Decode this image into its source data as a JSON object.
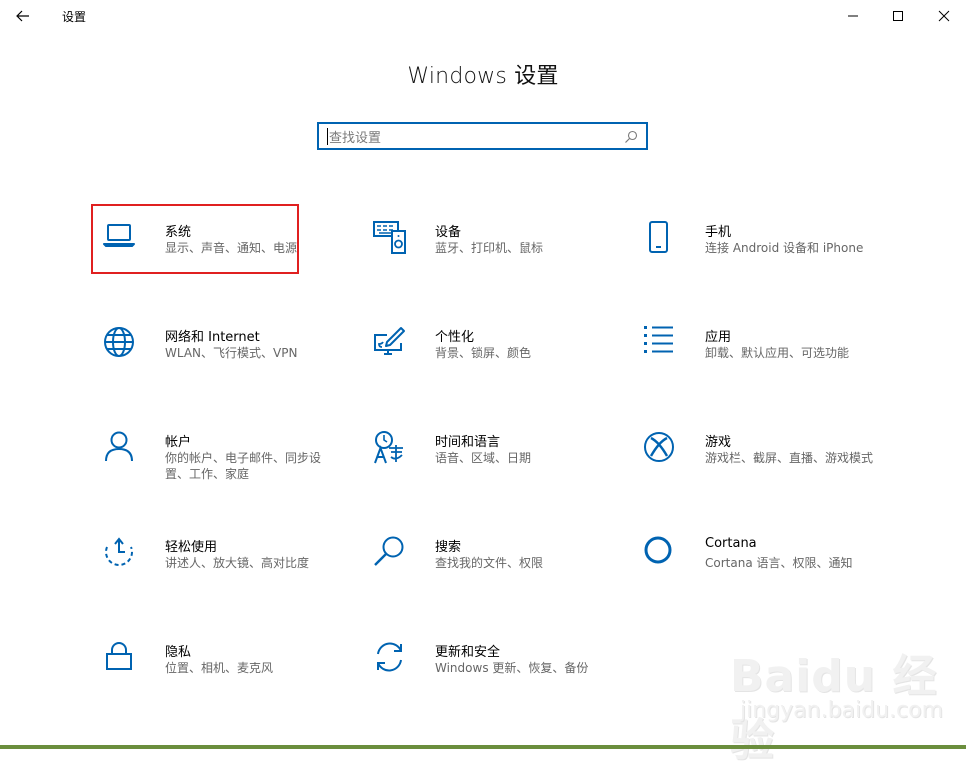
{
  "window": {
    "title": "设置"
  },
  "header": {
    "title": "Windows 设置"
  },
  "search": {
    "placeholder": "查找设置"
  },
  "tiles": [
    {
      "name": "系统",
      "desc": "显示、声音、通知、电源",
      "icon": "laptop-icon"
    },
    {
      "name": "设备",
      "desc": "蓝牙、打印机、鼠标",
      "icon": "devices-icon"
    },
    {
      "name": "手机",
      "desc": "连接 Android 设备和 iPhone",
      "icon": "phone-icon"
    },
    {
      "name": "网络和 Internet",
      "desc": "WLAN、飞行模式、VPN",
      "icon": "globe-icon"
    },
    {
      "name": "个性化",
      "desc": "背景、锁屏、颜色",
      "icon": "personalization-icon"
    },
    {
      "name": "应用",
      "desc": "卸载、默认应用、可选功能",
      "icon": "apps-list-icon"
    },
    {
      "name": "帐户",
      "desc": "你的帐户、电子邮件、同步设置、工作、家庭",
      "icon": "person-icon"
    },
    {
      "name": "时间和语言",
      "desc": "语音、区域、日期",
      "icon": "time-language-icon"
    },
    {
      "name": "游戏",
      "desc": "游戏栏、截屏、直播、游戏模式",
      "icon": "xbox-icon"
    },
    {
      "name": "轻松使用",
      "desc": "讲述人、放大镜、高对比度",
      "icon": "ease-of-access-icon"
    },
    {
      "name": "搜索",
      "desc": "查找我的文件、权限",
      "icon": "search-icon"
    },
    {
      "name": "Cortana",
      "desc": "Cortana 语言、权限、通知",
      "icon": "cortana-icon"
    },
    {
      "name": "隐私",
      "desc": "位置、相机、麦克风",
      "icon": "lock-icon"
    },
    {
      "name": "更新和安全",
      "desc": "Windows 更新、恢复、备份",
      "icon": "update-icon"
    }
  ],
  "watermark": {
    "text": "Baidu 经验",
    "sub": "jingyan.baidu.com"
  },
  "colors": {
    "accent": "#0063b1",
    "highlight": "#e02020"
  }
}
